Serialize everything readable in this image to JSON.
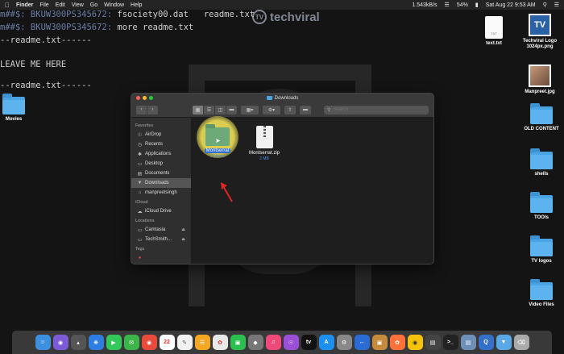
{
  "menubar": {
    "app": "Finder",
    "items": [
      "File",
      "Edit",
      "View",
      "Go",
      "Window",
      "Help"
    ],
    "speed": "1.543kB/s",
    "battery": "54%",
    "datetime": "Sat Aug 22  9:53 AM"
  },
  "terminal": {
    "line1_prompt": "m##$: BKUW300PS345672:",
    "line1_cmd": " fsociety00.dat   readme.txt",
    "line2_prompt": "m##$: BKUW300PS345672:",
    "line2_cmd": " more readme.txt",
    "line3": "--readme.txt------",
    "line4": "LEAVE ME HERE",
    "line5": "--readme.txt------"
  },
  "watermark": {
    "logo": "TV",
    "text": "techviral"
  },
  "desktop": {
    "left_folder": "Movies",
    "right_items": [
      {
        "label": "text.txt",
        "kind": "doc"
      },
      {
        "label": "Techviral Logo 1024px.png",
        "kind": "tv"
      },
      {
        "label": "Manpreet.jpg",
        "kind": "photo"
      },
      {
        "label": "OLD CONTENT",
        "kind": "folder"
      },
      {
        "label": "shells",
        "kind": "folder"
      },
      {
        "label": "TOOls",
        "kind": "folder"
      },
      {
        "label": "TV logos",
        "kind": "folder"
      },
      {
        "label": "Video Files",
        "kind": "folder"
      }
    ],
    "tv_icon_text": "TV"
  },
  "finder": {
    "title": "Downloads",
    "search_placeholder": "Search",
    "sidebar": {
      "favorites_header": "Favorites",
      "favorites": [
        "AirDrop",
        "Recents",
        "Applications",
        "Desktop",
        "Documents",
        "Downloads",
        "manpreetsingh"
      ],
      "icloud_header": "iCloud",
      "icloud": [
        "iCloud Drive"
      ],
      "locations_header": "Locations",
      "locations": [
        "Camtasia",
        "TechSmith..."
      ],
      "tags_header": "Tags"
    },
    "files": [
      {
        "name": "Montserrat",
        "size": "11 items"
      },
      {
        "name": "Montserrat.zip",
        "size": "2 MB"
      }
    ]
  },
  "colors": {
    "accent": "#2f6fd4",
    "folder": "#4aa3e3",
    "highlight": "#f5e05a"
  }
}
